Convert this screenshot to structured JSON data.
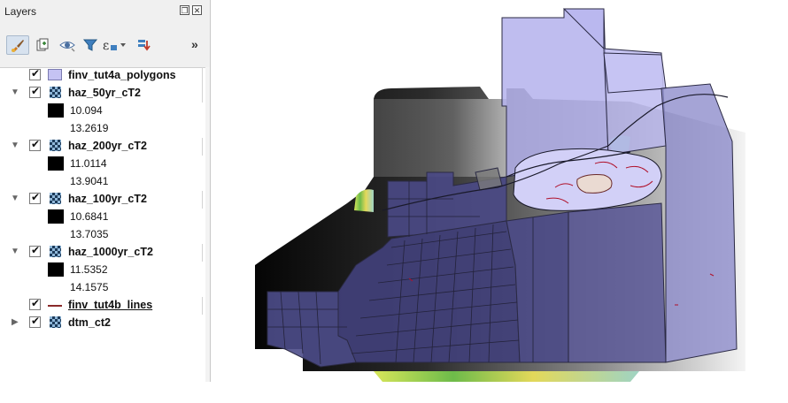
{
  "panel": {
    "title": "Layers",
    "float_btn": "❐",
    "close_btn": "✕",
    "more": "»"
  },
  "toolbar": {
    "buttons": [
      {
        "name": "style-manager-button",
        "glyph": "✎"
      },
      {
        "name": "add-group-button",
        "glyph": "⎘"
      },
      {
        "name": "visibility-button",
        "glyph": "◉"
      },
      {
        "name": "filter-legend-button",
        "glyph": "▼"
      },
      {
        "name": "filter-expression-button",
        "glyph": "ε"
      },
      {
        "name": "expand-all-button",
        "glyph": "⇩"
      }
    ]
  },
  "layers": [
    {
      "name": "finv_tut4a_polygons",
      "type": "polygon",
      "checked": true
    },
    {
      "name": "haz_50yr_cT2",
      "type": "raster",
      "checked": true,
      "expanded": true,
      "min": "10.094",
      "max": "13.2619"
    },
    {
      "name": "haz_200yr_cT2",
      "type": "raster",
      "checked": true,
      "expanded": true,
      "min": "11.0114",
      "max": "13.9041"
    },
    {
      "name": "haz_100yr_cT2",
      "type": "raster",
      "checked": true,
      "expanded": true,
      "min": "10.6841",
      "max": "13.7035"
    },
    {
      "name": "haz_1000yr_cT2",
      "type": "raster",
      "checked": true,
      "expanded": true,
      "min": "11.5352",
      "max": "14.1575"
    },
    {
      "name": "finv_tut4b_lines",
      "type": "line",
      "checked": true
    },
    {
      "name": "dtm_ct2",
      "type": "raster",
      "checked": true,
      "expanded": false
    }
  ],
  "colors": {
    "polygon_fill": "#c5c3f3",
    "polygon_dark": "#3b3a73",
    "line_color": "#8a2a2a",
    "flood_red": "#b0112a"
  }
}
